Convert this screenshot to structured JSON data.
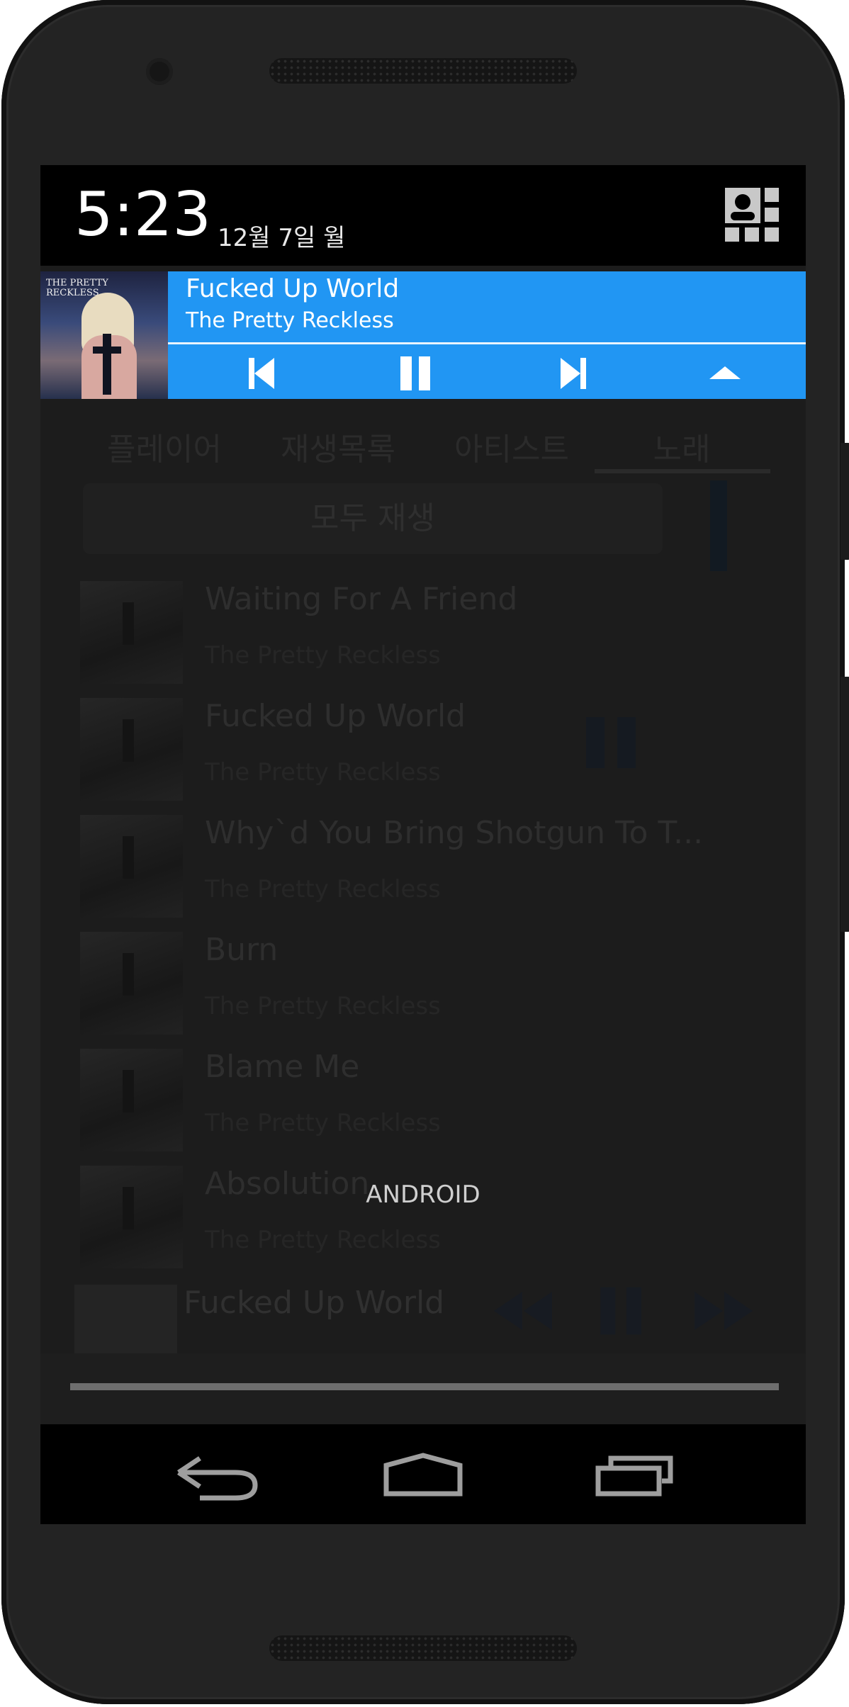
{
  "status_bar": {
    "time": "5:23",
    "date": "12월 7일 월"
  },
  "notification": {
    "song_title": "Fucked Up World",
    "artist": "The Pretty Reckless",
    "controls": [
      "previous",
      "pause",
      "next",
      "collapse"
    ],
    "accent_color": "#2196f3"
  },
  "app": {
    "tabs": [
      "플레이어",
      "재생목록",
      "아티스트",
      "노래"
    ],
    "play_all": "모두 재생",
    "songs": [
      {
        "title": "Waiting For A Friend",
        "artist": "The Pretty Reckless"
      },
      {
        "title": "Fucked Up World",
        "artist": "The Pretty Reckless"
      },
      {
        "title": "Why`d You Bring Shotgun To T...",
        "artist": "The Pretty Reckless"
      },
      {
        "title": "Burn",
        "artist": "The Pretty Reckless"
      },
      {
        "title": "Blame Me",
        "artist": "The Pretty Reckless"
      },
      {
        "title": "Absolution",
        "artist": "The Pretty Reckless"
      }
    ],
    "mini_player": {
      "title": "Fucked Up World"
    },
    "watermark": "ANDROID"
  },
  "nav_bar": {
    "buttons": [
      "back-icon",
      "home-icon",
      "recents-icon"
    ]
  }
}
